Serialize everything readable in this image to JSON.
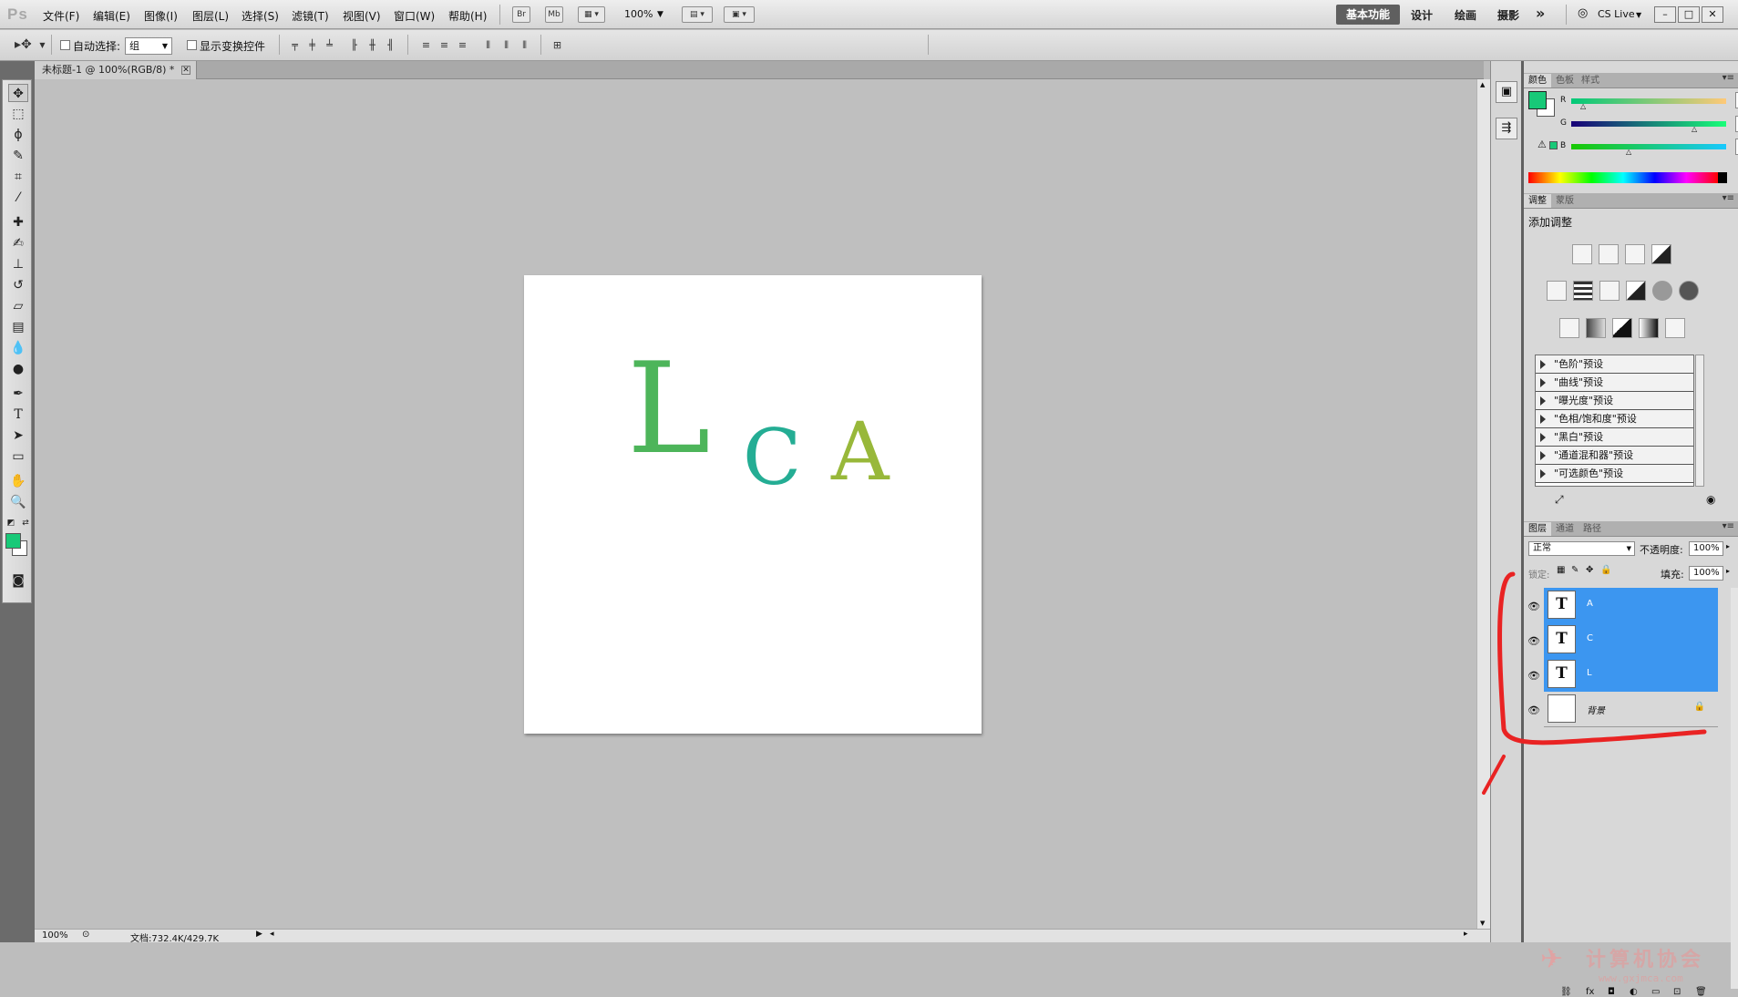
{
  "app": {
    "logo": "Ps",
    "menu": [
      "文件(F)",
      "编辑(E)",
      "图像(I)",
      "图层(L)",
      "选择(S)",
      "滤镜(T)",
      "视图(V)",
      "窗口(W)",
      "帮助(H)"
    ],
    "bridge_btn": "Br",
    "minibridge_btn": "Mb",
    "zoom_select": "100%",
    "workspaces": {
      "active": "基本功能",
      "items": [
        "设计",
        "绘画",
        "摄影"
      ],
      "more": "»"
    },
    "cs_live": "CS Live",
    "window_controls": [
      "–",
      "□",
      "✕"
    ]
  },
  "options_bar": {
    "auto_select_label": "自动选择:",
    "auto_select_value": "组",
    "show_transform_label": "显示变换控件"
  },
  "document": {
    "tab_title": "未标题-1 @ 100%(RGB/8) *",
    "tab_close": "✕",
    "letters": [
      {
        "char": "L",
        "color": "#4db55a"
      },
      {
        "char": "C",
        "color": "#24ad94"
      },
      {
        "char": "A",
        "color": "#98b83a"
      }
    ]
  },
  "status_bar": {
    "zoom": "100%",
    "doc_info": "文档:732.4K/429.7K"
  },
  "color_panel": {
    "tabs": [
      "颜色",
      "色板",
      "样式"
    ],
    "foreground": "#18c978",
    "background": "#ffffff",
    "channels": [
      {
        "label": "R",
        "value": "24"
      },
      {
        "label": "G",
        "value": "201"
      },
      {
        "label": "B",
        "value": "120"
      }
    ]
  },
  "adjustments_panel": {
    "tabs": [
      "调整",
      "蒙版"
    ],
    "title": "添加调整",
    "presets": [
      "\"色阶\"预设",
      "\"曲线\"预设",
      "\"曝光度\"预设",
      "\"色相/饱和度\"预设",
      "\"黑白\"预设",
      "\"通道混和器\"预设",
      "\"可选颜色\"预设"
    ]
  },
  "layers_panel": {
    "tabs": [
      "图层",
      "通道",
      "路径"
    ],
    "blend_mode": "正常",
    "opacity_label": "不透明度:",
    "opacity_value": "100%",
    "lock_label": "锁定:",
    "fill_label": "填充:",
    "fill_value": "100%",
    "layers": [
      {
        "name": "A",
        "type": "text",
        "thumb": "T",
        "selected": true
      },
      {
        "name": "C",
        "type": "text",
        "thumb": "T",
        "selected": true
      },
      {
        "name": "L",
        "type": "text",
        "thumb": "T",
        "selected": true
      },
      {
        "name": "背景",
        "type": "background",
        "thumb": "",
        "selected": false
      }
    ],
    "selected_color": "#3c96f0"
  },
  "watermark": {
    "title": "计算机协会",
    "url": "www.gxjmca.com"
  }
}
